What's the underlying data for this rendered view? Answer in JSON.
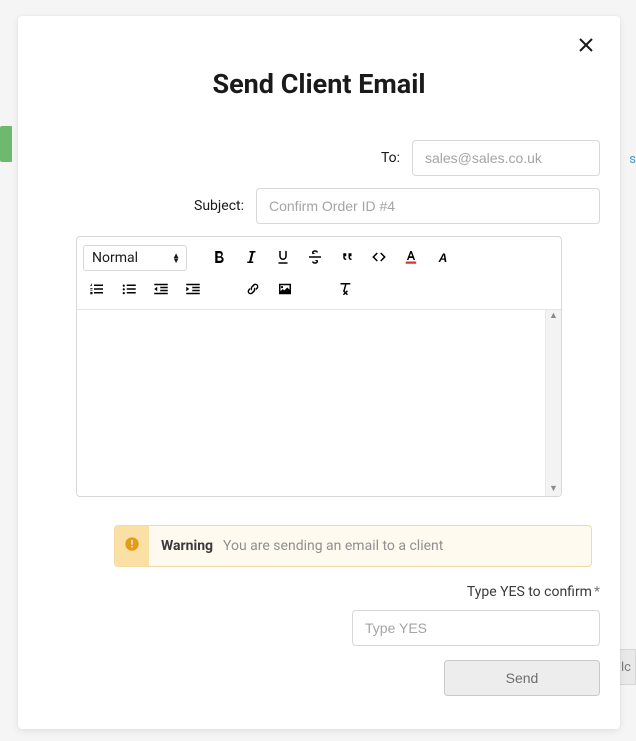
{
  "modal": {
    "title": "Send Client Email",
    "to": {
      "label": "To:",
      "placeholder": "sales@sales.co.uk",
      "value": ""
    },
    "subject": {
      "label": "Subject:",
      "placeholder": "Confirm Order ID #4",
      "value": ""
    }
  },
  "editor": {
    "format_picker": "Normal",
    "tools_row1": [
      "bold",
      "italic",
      "underline",
      "strike",
      "quote",
      "code",
      "text-color",
      "highlight"
    ],
    "tools_row2": [
      "ordered-list",
      "bullet-list",
      "outdent",
      "indent",
      "link",
      "image",
      "clear-format"
    ]
  },
  "warning": {
    "label": "Warning",
    "message": "You are sending an email to a client"
  },
  "confirm": {
    "label": "Type YES to confirm",
    "required_mark": "*",
    "placeholder": "Type YES",
    "value": ""
  },
  "actions": {
    "send": "Send"
  },
  "background": {
    "right_link_fragment": "s",
    "right_btn_fragment": "lc"
  }
}
